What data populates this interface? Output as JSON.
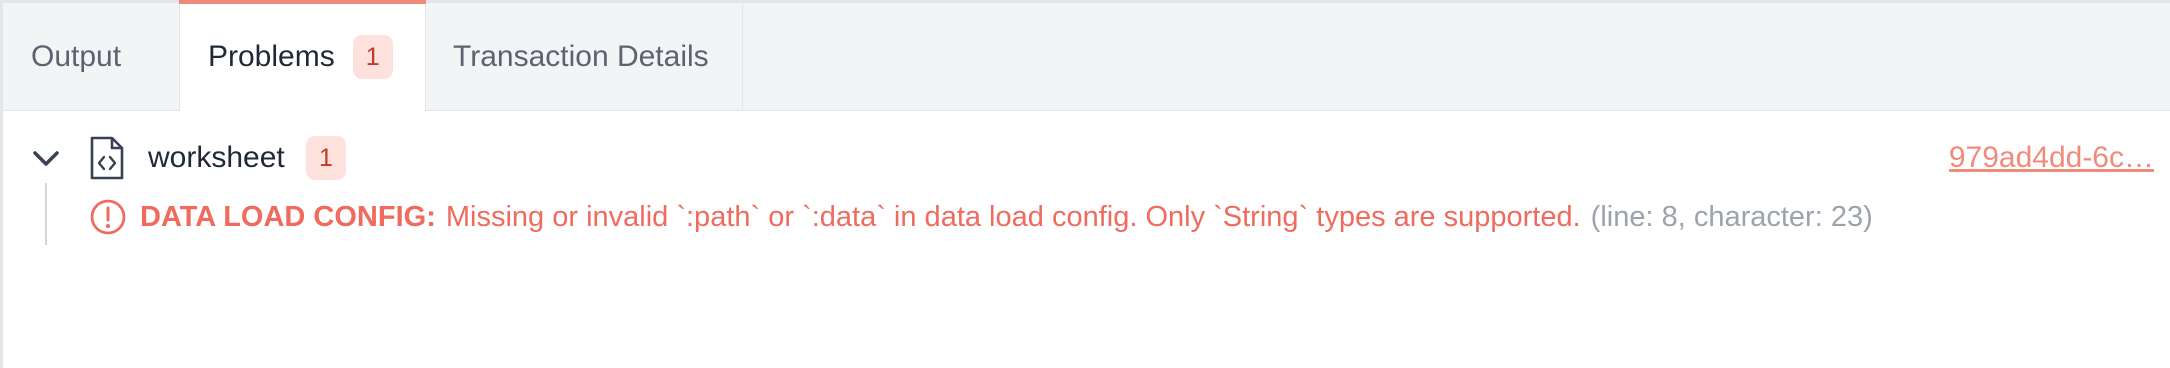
{
  "tabs": [
    {
      "label": "Output"
    },
    {
      "label": "Problems",
      "badge": "1"
    },
    {
      "label": "Transaction Details"
    }
  ],
  "problems": {
    "file": {
      "name": "worksheet",
      "badge": "1",
      "transaction_link": "979ad4dd-6c…"
    },
    "items": [
      {
        "code": "DATA LOAD CONFIG:",
        "message": "Missing or invalid `:path` or `:data` in data load config. Only `String` types are supported.",
        "location": "(line: 8, character: 23)"
      }
    ]
  },
  "colors": {
    "accent": "#f08b7c",
    "error": "#ef6b5e",
    "badge_bg": "#fde1dc",
    "muted": "#9ca3af"
  },
  "icons": {
    "expand": "chevron-down-icon",
    "file": "code-file-icon",
    "error": "error-circle-icon"
  }
}
